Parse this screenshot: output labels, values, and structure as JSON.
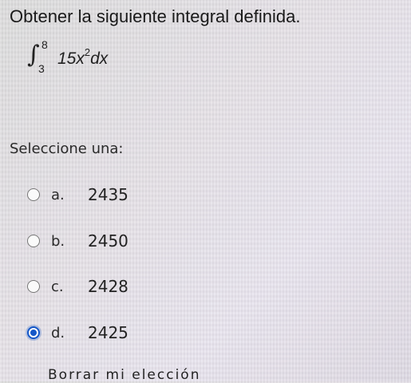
{
  "question": {
    "text": "Obtener la siguiente integral definida.",
    "integral": {
      "sign": "∫",
      "upper": "8",
      "lower": "3",
      "coefficient": "15x",
      "exponent": "2",
      "differential": "dx"
    }
  },
  "prompt": "Seleccione una:",
  "options": [
    {
      "letter": "a.",
      "value": "2435",
      "selected": false
    },
    {
      "letter": "b.",
      "value": "2450",
      "selected": false
    },
    {
      "letter": "c.",
      "value": "2428",
      "selected": false
    },
    {
      "letter": "d.",
      "value": "2425",
      "selected": true
    }
  ],
  "clear_label": "Borrar mi elección",
  "colors": {
    "radio_selected": "#1557c8"
  }
}
